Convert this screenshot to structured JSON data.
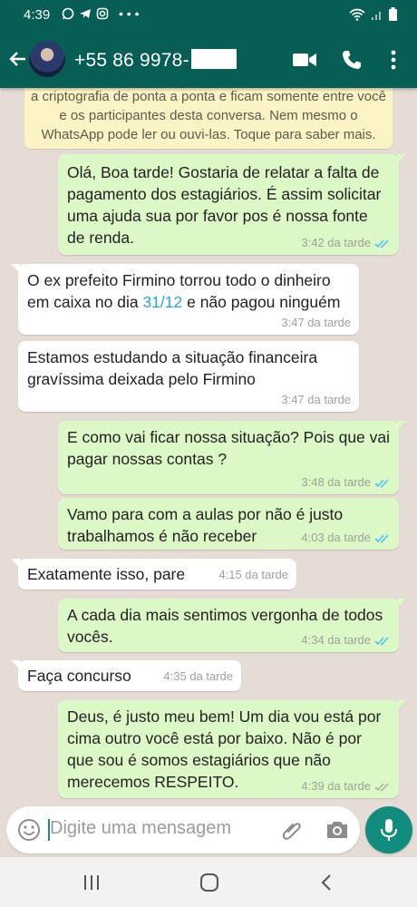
{
  "status": {
    "time": "4:39"
  },
  "header": {
    "contact": "+55 86 9978-"
  },
  "chat": {
    "notice": "a criptografia de ponta a ponta e ficam somente entre você e os participantes desta conversa. Nem mesmo o WhatsApp pode ler ou ouvi-las. Toque para saber mais.",
    "messages": [
      {
        "side": "out",
        "text": "Olá, Boa tarde! Gostaria  de relatar  a falta de pagamento  dos estagiários. É assim solicitar  uma ajuda sua por favor  pos é nossa  fonte de renda.",
        "time": "3:42 da tarde",
        "read": true
      },
      {
        "side": "in",
        "text_before": "O ex prefeito Firmino torrou todo o dinheiro em caixa no dia ",
        "date_link": "31/12",
        "text_after": " e não pagou ninguém",
        "time": "3:47 da tarde"
      },
      {
        "side": "in",
        "text": "Estamos estudando a situação financeira gravíssima deixada pelo Firmino",
        "time": "3:47 da tarde"
      },
      {
        "side": "out",
        "text": "E como vai ficar  nossa situação? Pois que vai pagar  nossas contas ?",
        "time": "3:48 da tarde",
        "read": true
      },
      {
        "side": "out",
        "text": "Vamo para com a aulas por não  é justo trabalhamos é  não receber",
        "time": "4:03 da tarde",
        "read": true
      },
      {
        "side": "in",
        "text": "Exatamente isso, pare",
        "time": "4:15 da tarde"
      },
      {
        "side": "out",
        "text": "A cada dia mais sentimos vergonha de todos vocês.",
        "time": "4:34 da tarde",
        "read": true
      },
      {
        "side": "in",
        "text": "Faça concurso",
        "time": "4:35 da tarde"
      },
      {
        "side": "out",
        "text": "Deus, é justo meu bem! Um dia vou  está por cima outro você está por baixo.  Não é por que sou é somos  estagiários  que não  merecemos RESPEITO.",
        "time": "4:39 da tarde",
        "read": false
      }
    ]
  },
  "composer": {
    "placeholder": "Digite uma mensagem"
  },
  "colors": {
    "header": "#075e54",
    "outgoing": "#dcf8c6",
    "incoming": "#ffffff",
    "read_ticks": "#4fc3f7",
    "accent": "#128c7e"
  },
  "icons": [
    "back-arrow-icon",
    "video-call-icon",
    "phone-icon",
    "more-vert-icon",
    "emoji-icon",
    "attach-icon",
    "camera-icon",
    "mic-icon",
    "recent-apps-icon",
    "home-icon",
    "nav-back-icon"
  ]
}
